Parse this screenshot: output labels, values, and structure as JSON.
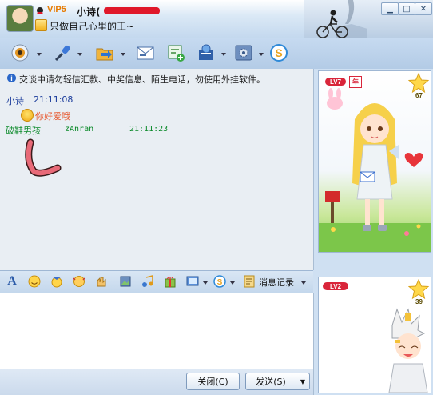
{
  "window": {
    "vip_label": "VIP5",
    "nickname": "小诗(",
    "signature": "只做自己心里的王~",
    "controls": [
      "minimize",
      "maximize",
      "close"
    ]
  },
  "toolbar": {
    "icons": [
      "video-call-icon",
      "voice-call-icon",
      "send-file-icon",
      "email-icon",
      "add-app-icon",
      "remote-assist-icon",
      "settings-icon",
      "soso-icon"
    ]
  },
  "chat": {
    "notice": "交谈中请勿轻信汇款、中奖信息、陌生电话，勿使用外挂软件。",
    "messages": [
      {
        "sender": "小诗",
        "time": "21:11:08",
        "text": "你好爱哦",
        "color": "#e8572d"
      },
      {
        "sender": "破鞋男孩",
        "user": "zAnran",
        "time": "21:11:23"
      }
    ]
  },
  "input_toolbar": {
    "history_label": "消息记录"
  },
  "buttons": {
    "close": "关闭(C)",
    "send": "发送(S)"
  },
  "show_panels": {
    "top": {
      "level": "LV7",
      "badge": "年",
      "star_count": "67"
    },
    "bottom": {
      "level": "LV2",
      "star_count": "39"
    }
  },
  "colors": {
    "sender_self": "#1c3d9c",
    "sender_other": "#0b8a2a",
    "accent": "#e67a00"
  }
}
